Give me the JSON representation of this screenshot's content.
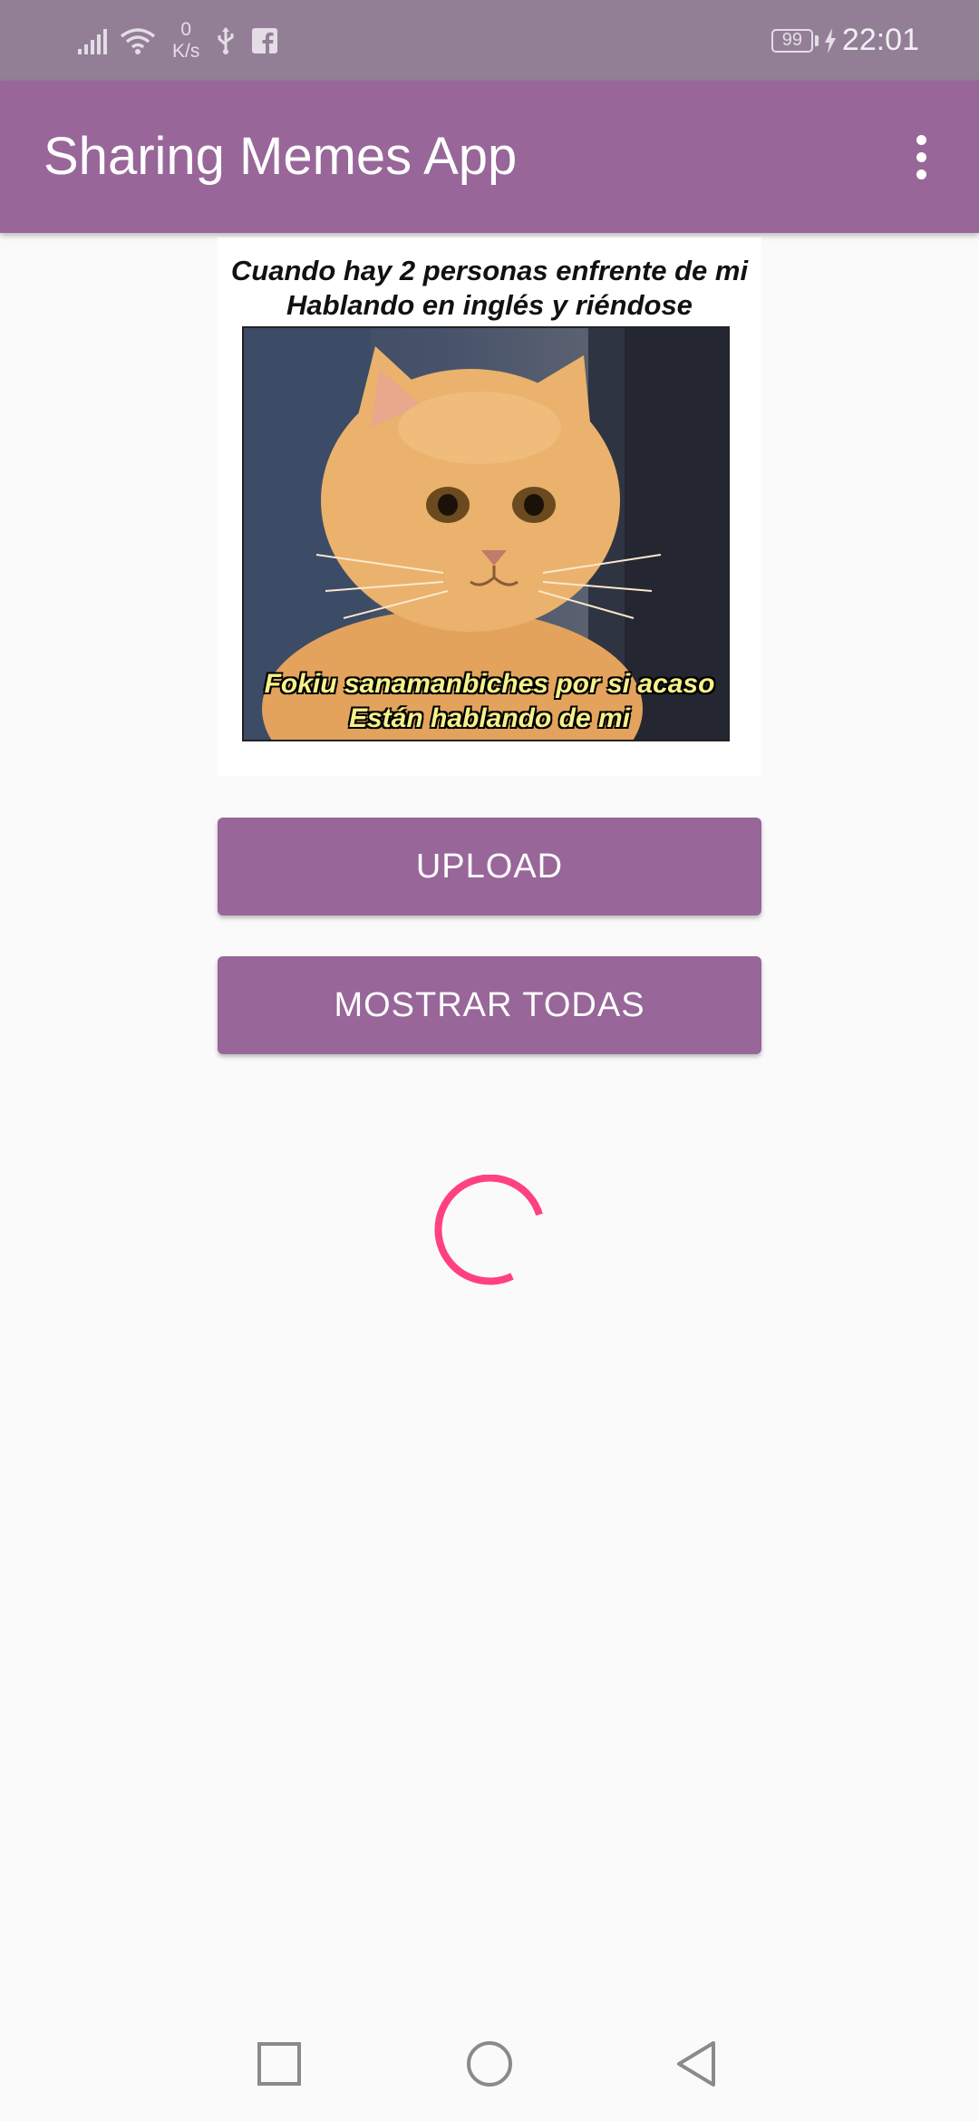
{
  "status_bar": {
    "net_speed_value": "0",
    "net_speed_unit": "K/s",
    "battery_level": "99",
    "time": "22:01",
    "icons": [
      "signal-icon",
      "wifi-icon",
      "usb-icon",
      "facebook-icon",
      "battery-icon",
      "charging-icon"
    ]
  },
  "app_bar": {
    "title": "Sharing Memes App",
    "overflow_icon": "more-vert-icon"
  },
  "meme": {
    "caption_top_line1": "Cuando hay 2 personas enfrente de mi",
    "caption_top_line2": "Hablando en inglés y riéndose",
    "caption_bottom_line1": "Fokiu sanamanbiches por si acaso",
    "caption_bottom_line2": "Están hablando de mi"
  },
  "buttons": {
    "upload_label": "UPLOAD",
    "show_all_label": "MOSTRAR TODAS"
  },
  "colors": {
    "primary": "#986699",
    "status_bar": "#927f96",
    "spinner": "#ff4081",
    "background": "#fafafa"
  },
  "nav_bar": {
    "icons": [
      "recents-square-icon",
      "home-circle-icon",
      "back-triangle-icon"
    ]
  }
}
